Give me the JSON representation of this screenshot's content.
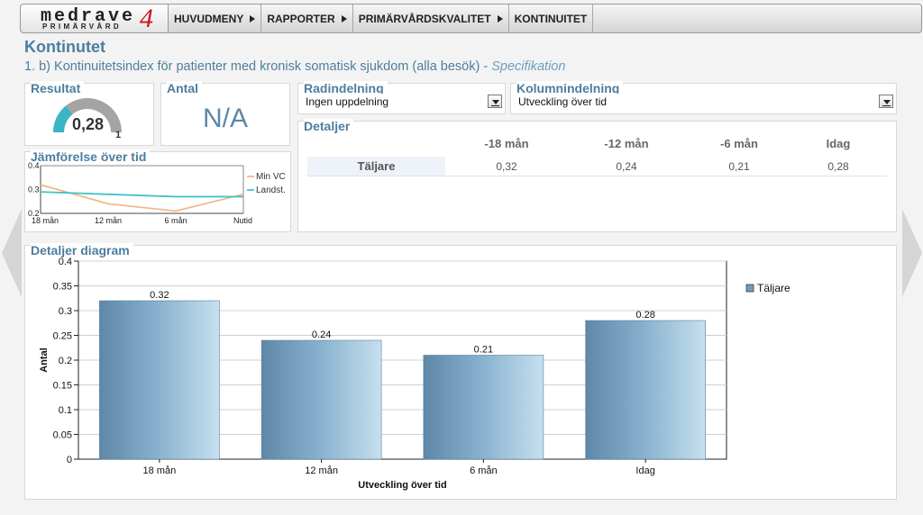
{
  "nav": {
    "logo_main": "medrave",
    "logo_sub": "PRIMÄRVÅRD",
    "logo_num": "4",
    "items": [
      {
        "label": "HUVUDMENY"
      },
      {
        "label": "RAPPORTER"
      },
      {
        "label": "PRIMÄRVÅRDSKVALITET"
      },
      {
        "label": "KONTINUITET"
      }
    ]
  },
  "page": {
    "title": "Kontinutet",
    "subtitle": "1. b) Kontinuitetsindex för patienter med kronisk somatisk sjukdom (alla besök) -",
    "spec_link": "Specifikation"
  },
  "resultat": {
    "title": "Resultat",
    "value": "0,28",
    "max_label": "1",
    "fraction": 0.28,
    "gauge_color": "#3ab5c3"
  },
  "antal": {
    "title": "Antal",
    "value": "N/A"
  },
  "radindelning": {
    "title": "Radindelning",
    "selected": "Ingen uppdelning"
  },
  "kolumnindelning": {
    "title": "Kolumnindelning",
    "selected": "Utveckling över tid"
  },
  "detaljer": {
    "title": "Detaljer",
    "columns": [
      "-18 mån",
      "-12 mån",
      "-6 mån",
      "Idag"
    ],
    "rows": [
      {
        "label": "Täljare",
        "values": [
          "0,32",
          "0,24",
          "0,21",
          "0,28"
        ]
      }
    ]
  },
  "jamforelse": {
    "title": "Jämförelse över tid",
    "chart_data": {
      "type": "line",
      "categories": [
        "18 mån",
        "12 mån",
        "6 mån",
        "Nutid"
      ],
      "ylim": [
        0.2,
        0.4
      ],
      "yticks": [
        "0.4",
        "0.3",
        "0.2"
      ],
      "series": [
        {
          "name": "Min VC",
          "values": [
            0.32,
            0.24,
            0.21,
            0.28
          ],
          "color": "#f2b98a"
        },
        {
          "name": "Landst.",
          "values": [
            0.29,
            0.28,
            0.27,
            0.27
          ],
          "color": "#43c3c6"
        }
      ]
    }
  },
  "diagram": {
    "title": "Detaljer diagram",
    "chart_data": {
      "type": "bar",
      "categories": [
        "18 mån",
        "12 mån",
        "6 mån",
        "Idag"
      ],
      "values": [
        0.32,
        0.24,
        0.21,
        0.28
      ],
      "data_labels": [
        "0.32",
        "0.24",
        "0.21",
        "0.28"
      ],
      "xlabel": "Utveckling över tid",
      "ylabel": "Antal",
      "ylim": [
        0,
        0.4
      ],
      "yticks": [
        "0",
        "0.05",
        "0.1",
        "0.15",
        "0.2",
        "0.25",
        "0.3",
        "0.35",
        "0.4"
      ],
      "grid": true,
      "legend": "top-right",
      "series": [
        {
          "name": "Täljare",
          "color": "#6f9cbc"
        }
      ]
    }
  }
}
